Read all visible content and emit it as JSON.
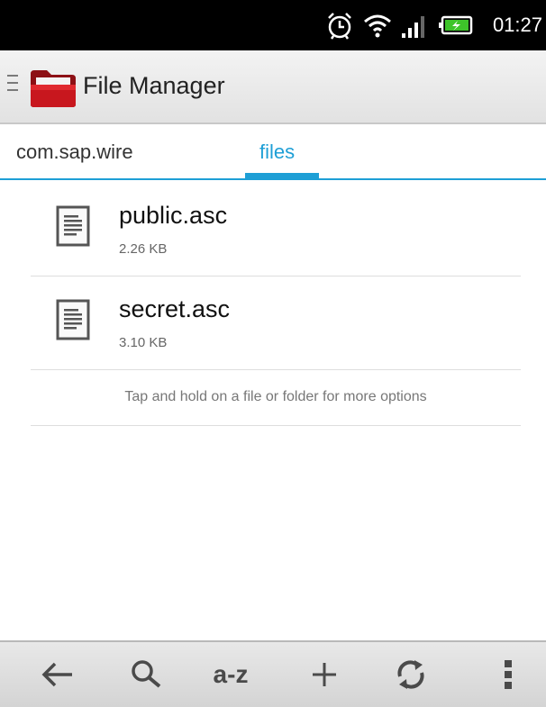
{
  "status_bar": {
    "time": "01:27",
    "icons": [
      "alarm-icon",
      "wifi-icon",
      "signal-icon",
      "battery-icon"
    ]
  },
  "action_bar": {
    "title": "File Manager",
    "icons": [
      "menu-icon",
      "folder-app-icon"
    ]
  },
  "tabs": [
    {
      "label": "com.sap.wire",
      "active": false
    },
    {
      "label": "files",
      "active": true
    }
  ],
  "files": [
    {
      "name": "public.asc",
      "size": "2.26 KB",
      "icon": "document-icon"
    },
    {
      "name": "secret.asc",
      "size": "3.10 KB",
      "icon": "document-icon"
    }
  ],
  "hint": "Tap and hold on a file or folder for more options",
  "toolbar": {
    "sort_label": "a-z",
    "icons": [
      "back-arrow-icon",
      "search-icon",
      "sort-az-icon",
      "add-icon",
      "refresh-icon",
      "overflow-menu-icon"
    ]
  },
  "colors": {
    "accent": "#1e9fd6",
    "status_bar": "#000000",
    "action_bar": "#ebebeb",
    "toolbar": "#dcdcdc",
    "folder_red": "#c0161d"
  }
}
